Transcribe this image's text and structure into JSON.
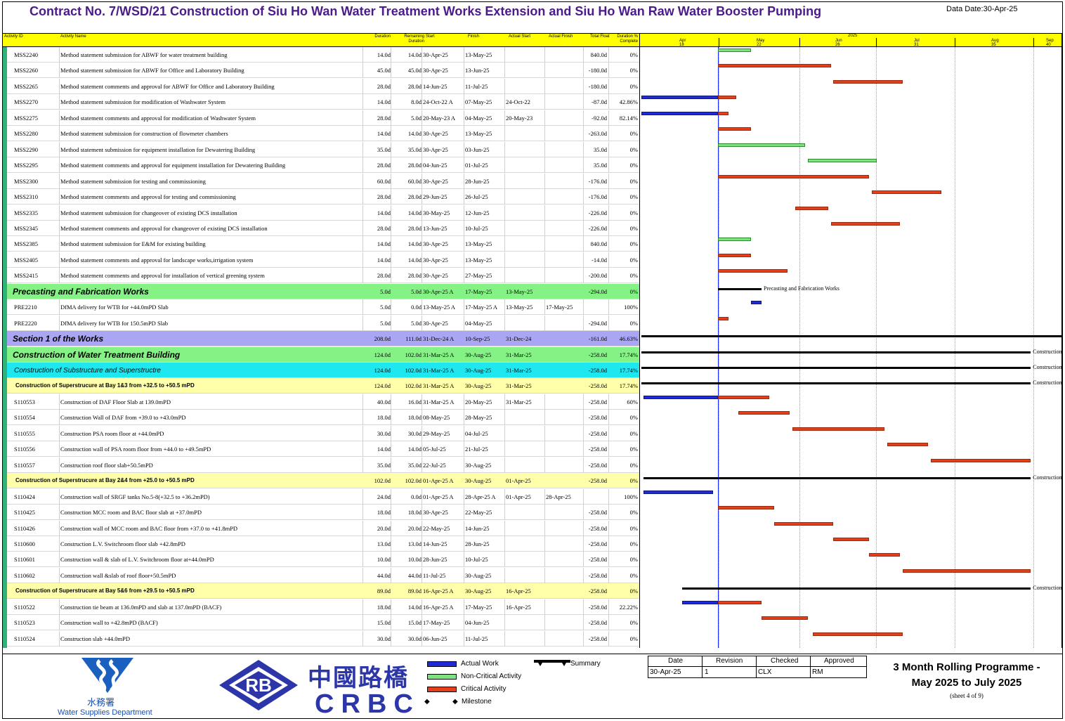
{
  "title": "Contract No. 7/WSD/21 Construction of Siu Ho Wan Water Treatment Works Extension and Siu Ho Wan Raw Water Booster Pumping",
  "data_date": "Data Date:30-Apr-25",
  "columns": {
    "id": "Activity ID",
    "name": "Activity Name",
    "od": "Duration",
    "rd": "Remaining Duration",
    "start": "Start",
    "finish": "Finish",
    "as": "Actual Start",
    "af": "Actual Finish",
    "tf": "Total Float",
    "pc": "Duration % Complete"
  },
  "timeline": {
    "year": "2025",
    "months": [
      "Apr",
      "May",
      "Jun",
      "Jul",
      "Aug",
      "Sep"
    ],
    "weeks": [
      "18",
      "22",
      "26",
      "31",
      "35",
      "40"
    ]
  },
  "colors": {
    "critical": "#e23f1d",
    "non_critical": "#7fe07f",
    "actual": "#1f2bd6",
    "summary": "#000000",
    "group_green": "#85f285",
    "group_purple": "#aaa6f4",
    "group_cyan": "#1fe7ef",
    "group_yellow": "#ffffaa"
  },
  "rows": [
    {
      "type": "act",
      "id": "MSS2240",
      "name": "Method statement submission for ABWF for water treatment building",
      "od": "14.0d",
      "rd": "14.0d",
      "start": "30-Apr-25",
      "finish": "13-May-25",
      "as": "",
      "af": "",
      "tf": "840.0d",
      "pc": "0%",
      "bars": [
        {
          "kind": "nonc",
          "s": 0,
          "e": 13
        }
      ]
    },
    {
      "type": "act",
      "id": "MSS2260",
      "name": "Method statement submission for ABWF for Office and Laboratory Building",
      "od": "45.0d",
      "rd": "45.0d",
      "start": "30-Apr-25",
      "finish": "13-Jun-25",
      "as": "",
      "af": "",
      "tf": "-180.0d",
      "pc": "0%",
      "bars": [
        {
          "kind": "crit",
          "s": 0,
          "e": 44
        }
      ]
    },
    {
      "type": "act",
      "id": "MSS2265",
      "name": "Method statement comments and approval for ABWF for Office and Laboratory Building",
      "od": "28.0d",
      "rd": "28.0d",
      "start": "14-Jun-25",
      "finish": "11-Jul-25",
      "as": "",
      "af": "",
      "tf": "-180.0d",
      "pc": "0%",
      "bars": [
        {
          "kind": "crit",
          "s": 45,
          "e": 72
        }
      ]
    },
    {
      "type": "act",
      "id": "MSS2270",
      "name": "Method statement submission for modification of Washwater System",
      "od": "14.0d",
      "rd": "8.0d",
      "start": "24-Oct-22 A",
      "finish": "07-May-25",
      "as": "24-Oct-22",
      "af": "",
      "tf": "-87.0d",
      "pc": "42.86%",
      "bars": [
        {
          "kind": "act",
          "s": -30,
          "e": 0
        },
        {
          "kind": "crit",
          "s": 0,
          "e": 7
        }
      ]
    },
    {
      "type": "act",
      "id": "MSS2275",
      "name": "Method statement comments and approval for modification of Washwater System",
      "od": "28.0d",
      "rd": "5.0d",
      "start": "20-May-23 A",
      "finish": "04-May-25",
      "as": "20-May-23",
      "af": "",
      "tf": "-92.0d",
      "pc": "82.14%",
      "bars": [
        {
          "kind": "act",
          "s": -30,
          "e": 0
        },
        {
          "kind": "crit",
          "s": 0,
          "e": 4
        }
      ]
    },
    {
      "type": "act",
      "id": "MSS2280",
      "name": "Method statement submission for construction of flowmeter chambers",
      "od": "14.0d",
      "rd": "14.0d",
      "start": "30-Apr-25",
      "finish": "13-May-25",
      "as": "",
      "af": "",
      "tf": "-263.0d",
      "pc": "0%",
      "bars": [
        {
          "kind": "crit",
          "s": 0,
          "e": 13
        }
      ]
    },
    {
      "type": "act",
      "id": "MSS2290",
      "name": "Method statement submission for equipment installation for Dewatering Building",
      "od": "35.0d",
      "rd": "35.0d",
      "start": "30-Apr-25",
      "finish": "03-Jun-25",
      "as": "",
      "af": "",
      "tf": "35.0d",
      "pc": "0%",
      "bars": [
        {
          "kind": "nonc",
          "s": 0,
          "e": 34
        }
      ]
    },
    {
      "type": "act",
      "id": "MSS2295",
      "name": "Method statement comments and approval for equipment installation for Dewatering Building",
      "od": "28.0d",
      "rd": "28.0d",
      "start": "04-Jun-25",
      "finish": "01-Jul-25",
      "as": "",
      "af": "",
      "tf": "35.0d",
      "pc": "0%",
      "bars": [
        {
          "kind": "nonc",
          "s": 35,
          "e": 62
        }
      ]
    },
    {
      "type": "act",
      "id": "MSS2300",
      "name": "Method statement submission for testing and commissioning",
      "od": "60.0d",
      "rd": "60.0d",
      "start": "30-Apr-25",
      "finish": "28-Jun-25",
      "as": "",
      "af": "",
      "tf": "-176.0d",
      "pc": "0%",
      "bars": [
        {
          "kind": "crit",
          "s": 0,
          "e": 59
        }
      ]
    },
    {
      "type": "act",
      "id": "MSS2310",
      "name": "Method statement comments and approval for testing and commissioning",
      "od": "28.0d",
      "rd": "28.0d",
      "start": "29-Jun-25",
      "finish": "26-Jul-25",
      "as": "",
      "af": "",
      "tf": "-176.0d",
      "pc": "0%",
      "bars": [
        {
          "kind": "crit",
          "s": 60,
          "e": 87
        }
      ]
    },
    {
      "type": "act",
      "id": "MSS2335",
      "name": "Method statement submission for changeover of existing DCS installation",
      "od": "14.0d",
      "rd": "14.0d",
      "start": "30-May-25",
      "finish": "12-Jun-25",
      "as": "",
      "af": "",
      "tf": "-226.0d",
      "pc": "0%",
      "bars": [
        {
          "kind": "crit",
          "s": 30,
          "e": 43
        }
      ]
    },
    {
      "type": "act",
      "id": "MSS2345",
      "name": "Method statement comments and approval for changeover of existing DCS installation",
      "od": "28.0d",
      "rd": "28.0d",
      "start": "13-Jun-25",
      "finish": "10-Jul-25",
      "as": "",
      "af": "",
      "tf": "-226.0d",
      "pc": "0%",
      "bars": [
        {
          "kind": "crit",
          "s": 44,
          "e": 71
        }
      ]
    },
    {
      "type": "act",
      "id": "MSS2385",
      "name": "Method statement submission for E&M for existing building",
      "od": "14.0d",
      "rd": "14.0d",
      "start": "30-Apr-25",
      "finish": "13-May-25",
      "as": "",
      "af": "",
      "tf": "840.0d",
      "pc": "0%",
      "bars": [
        {
          "kind": "nonc",
          "s": 0,
          "e": 13
        }
      ]
    },
    {
      "type": "act",
      "id": "MSS2405",
      "name": "Method statement comments and approval for landscape works,irrigation system",
      "od": "14.0d",
      "rd": "14.0d",
      "start": "30-Apr-25",
      "finish": "13-May-25",
      "as": "",
      "af": "",
      "tf": "-14.0d",
      "pc": "0%",
      "bars": [
        {
          "kind": "crit",
          "s": 0,
          "e": 13
        }
      ]
    },
    {
      "type": "act",
      "id": "MSS2415",
      "name": "Method statement comments and approval for  installation of vertical greening system",
      "od": "28.0d",
      "rd": "28.0d",
      "start": "30-Apr-25",
      "finish": "27-May-25",
      "as": "",
      "af": "",
      "tf": "-200.0d",
      "pc": "0%",
      "bars": [
        {
          "kind": "crit",
          "s": 0,
          "e": 27
        }
      ]
    },
    {
      "type": "grp",
      "bg": "#85f285",
      "id": "Precasting and Fabrication Works",
      "name": "",
      "od": "5.0d",
      "rd": "5.0d",
      "start": "30-Apr-25 A",
      "finish": "17-May-25",
      "as": "13-May-25",
      "af": "",
      "tf": "-294.0d",
      "pc": "0%",
      "sum": {
        "s": 0,
        "e": 17
      },
      "label": "Precasting and Fabrication Works"
    },
    {
      "type": "act",
      "id": "PRE2210",
      "name": "DfMA delivery for WTB for +44.0mPD Slab",
      "od": "5.0d",
      "rd": "0.0d",
      "start": "13-May-25 A",
      "finish": "17-May-25 A",
      "as": "13-May-25",
      "af": "17-May-25",
      "tf": "",
      "pc": "100%",
      "bars": [
        {
          "kind": "act",
          "s": 13,
          "e": 17
        }
      ]
    },
    {
      "type": "act",
      "id": "PRE2220",
      "name": "DfMA delivery for WTB for 150.5mPD Slab",
      "od": "5.0d",
      "rd": "5.0d",
      "start": "30-Apr-25",
      "finish": "04-May-25",
      "as": "",
      "af": "",
      "tf": "-294.0d",
      "pc": "0%",
      "bars": [
        {
          "kind": "crit",
          "s": 0,
          "e": 4
        }
      ]
    },
    {
      "type": "grp",
      "bg": "#aaa6f4",
      "id": "Section 1 of the Works",
      "name": "",
      "od": "208.0d",
      "rd": "111.0d",
      "start": "31-Dec-24 A",
      "finish": "10-Sep-25",
      "as": "31-Dec-24",
      "af": "",
      "tf": "-161.0d",
      "pc": "46.63%",
      "sum": {
        "s": -30,
        "e": 135
      },
      "label": ""
    },
    {
      "type": "grp",
      "bg": "#85f285",
      "id": "Construction of Water Treatment Building",
      "name": "",
      "od": "124.0d",
      "rd": "102.0d",
      "start": "31-Mar-25 A",
      "finish": "30-Aug-25",
      "as": "31-Mar-25",
      "af": "",
      "tf": "-258.0d",
      "pc": "17.74%",
      "sum": {
        "s": -30,
        "e": 122
      },
      "label": "Construction"
    },
    {
      "type": "grp3",
      "bg": "#1fe7ef",
      "id": "Construction of Substructure and Superstructre",
      "name": "",
      "od": "124.0d",
      "rd": "102.0d",
      "start": "31-Mar-25 A",
      "finish": "30-Aug-25",
      "as": "31-Mar-25",
      "af": "",
      "tf": "-258.0d",
      "pc": "17.74%",
      "sum": {
        "s": -30,
        "e": 122
      },
      "label": "Construction"
    },
    {
      "type": "grp4",
      "bg": "#ffffaa",
      "id": "Construction of Superstrucure at Bay 1&3 from +32.5 to +50.5 mPD",
      "name": "",
      "od": "124.0d",
      "rd": "102.0d",
      "start": "31-Mar-25 A",
      "finish": "30-Aug-25",
      "as": "31-Mar-25",
      "af": "",
      "tf": "-258.0d",
      "pc": "17.74%",
      "sum": {
        "s": -30,
        "e": 122
      },
      "label": "Construction"
    },
    {
      "type": "act",
      "id": "S110553",
      "name": "Construction of DAF Floor Slab at 139.0mPD",
      "od": "40.0d",
      "rd": "16.0d",
      "start": "31-Mar-25 A",
      "finish": "20-May-25",
      "as": "31-Mar-25",
      "af": "",
      "tf": "-258.0d",
      "pc": "60%",
      "bars": [
        {
          "kind": "act",
          "s": -29,
          "e": 0
        },
        {
          "kind": "crit",
          "s": 0,
          "e": 20
        }
      ]
    },
    {
      "type": "act",
      "id": "S110554",
      "name": "Construction Wall of DAF from +39.0 to +43.0mPD",
      "od": "18.0d",
      "rd": "18.0d",
      "start": "08-May-25",
      "finish": "28-May-25",
      "as": "",
      "af": "",
      "tf": "-258.0d",
      "pc": "0%",
      "bars": [
        {
          "kind": "crit",
          "s": 8,
          "e": 28
        }
      ]
    },
    {
      "type": "act",
      "id": "S110555",
      "name": "Construction PSA room floor at +44.0mPD",
      "od": "30.0d",
      "rd": "30.0d",
      "start": "29-May-25",
      "finish": "04-Jul-25",
      "as": "",
      "af": "",
      "tf": "-258.0d",
      "pc": "0%",
      "bars": [
        {
          "kind": "crit",
          "s": 29,
          "e": 65
        }
      ]
    },
    {
      "type": "act",
      "id": "S110556",
      "name": "Construction wall of PSA room floor from +44.0 to +49.5mPD",
      "od": "14.0d",
      "rd": "14.0d",
      "start": "05-Jul-25",
      "finish": "21-Jul-25",
      "as": "",
      "af": "",
      "tf": "-258.0d",
      "pc": "0%",
      "bars": [
        {
          "kind": "crit",
          "s": 66,
          "e": 82
        }
      ]
    },
    {
      "type": "act",
      "id": "S110557",
      "name": "Construction roof floor slab+50.5mPD",
      "od": "35.0d",
      "rd": "35.0d",
      "start": "22-Jul-25",
      "finish": "30-Aug-25",
      "as": "",
      "af": "",
      "tf": "-258.0d",
      "pc": "0%",
      "bars": [
        {
          "kind": "crit",
          "s": 83,
          "e": 122
        }
      ]
    },
    {
      "type": "grp4",
      "bg": "#ffffaa",
      "id": "Construction of Superstrucure at Bay 2&4 from +25.0 to +50.5 mPD",
      "name": "",
      "od": "102.0d",
      "rd": "102.0d",
      "start": "01-Apr-25 A",
      "finish": "30-Aug-25",
      "as": "01-Apr-25",
      "af": "",
      "tf": "-258.0d",
      "pc": "0%",
      "sum": {
        "s": -29,
        "e": 122
      },
      "label": "Construction"
    },
    {
      "type": "act",
      "id": "S110424",
      "name": "Construction wall of SRGF tanks No.5-8(+32.5 to +36.2mPD)",
      "od": "24.0d",
      "rd": "0.0d",
      "start": "01-Apr-25 A",
      "finish": "28-Apr-25 A",
      "as": "01-Apr-25",
      "af": "28-Apr-25",
      "tf": "",
      "pc": "100%",
      "bars": [
        {
          "kind": "act",
          "s": -29,
          "e": -2
        }
      ]
    },
    {
      "type": "act",
      "id": "S110425",
      "name": "Construction MCC room and BAC floor slab at +37.0mPD",
      "od": "18.0d",
      "rd": "18.0d",
      "start": "30-Apr-25",
      "finish": "22-May-25",
      "as": "",
      "af": "",
      "tf": "-258.0d",
      "pc": "0%",
      "bars": [
        {
          "kind": "crit",
          "s": 0,
          "e": 22
        }
      ]
    },
    {
      "type": "act",
      "id": "S110426",
      "name": "Construction wall of MCC room and BAC floor from +37.0 to +41.8mPD",
      "od": "20.0d",
      "rd": "20.0d",
      "start": "22-May-25",
      "finish": "14-Jun-25",
      "as": "",
      "af": "",
      "tf": "-258.0d",
      "pc": "0%",
      "bars": [
        {
          "kind": "crit",
          "s": 22,
          "e": 45
        }
      ]
    },
    {
      "type": "act",
      "id": "S110600",
      "name": "Construction L.V. Switchroom floor slab +42.8mPD",
      "od": "13.0d",
      "rd": "13.0d",
      "start": "14-Jun-25",
      "finish": "28-Jun-25",
      "as": "",
      "af": "",
      "tf": "-258.0d",
      "pc": "0%",
      "bars": [
        {
          "kind": "crit",
          "s": 45,
          "e": 59
        }
      ]
    },
    {
      "type": "act",
      "id": "S110601",
      "name": "Construction wall & slab of L.V. Switchroom floor at+44.0mPD",
      "od": "10.0d",
      "rd": "10.0d",
      "start": "28-Jun-25",
      "finish": "10-Jul-25",
      "as": "",
      "af": "",
      "tf": "-258.0d",
      "pc": "0%",
      "bars": [
        {
          "kind": "crit",
          "s": 59,
          "e": 71
        }
      ]
    },
    {
      "type": "act",
      "id": "S110602",
      "name": "Construction wall &slab of roof floor+50.5mPD",
      "od": "44.0d",
      "rd": "44.0d",
      "start": "11-Jul-25",
      "finish": "30-Aug-25",
      "as": "",
      "af": "",
      "tf": "-258.0d",
      "pc": "0%",
      "bars": [
        {
          "kind": "crit",
          "s": 72,
          "e": 122
        }
      ]
    },
    {
      "type": "grp4",
      "bg": "#ffffaa",
      "id": "Construction of Superstrucure at Bay 5&6  from +29.5 to +50.5 mPD",
      "name": "",
      "od": "89.0d",
      "rd": "89.0d",
      "start": "16-Apr-25 A",
      "finish": "30-Aug-25",
      "as": "16-Apr-25",
      "af": "",
      "tf": "-258.0d",
      "pc": "0%",
      "sum": {
        "s": -14,
        "e": 122
      },
      "label": "Construction"
    },
    {
      "type": "act",
      "id": "S110522",
      "name": "Construction tie beam at 136.0mPD and slab at 137.0mPD (BACF)",
      "od": "18.0d",
      "rd": "14.0d",
      "start": "16-Apr-25 A",
      "finish": "17-May-25",
      "as": "16-Apr-25",
      "af": "",
      "tf": "-258.0d",
      "pc": "22.22%",
      "bars": [
        {
          "kind": "act",
          "s": -14,
          "e": 0
        },
        {
          "kind": "crit",
          "s": 0,
          "e": 17
        }
      ]
    },
    {
      "type": "act",
      "id": "S110523",
      "name": "Construction wall to +42.8mPD (BACF)",
      "od": "15.0d",
      "rd": "15.0d",
      "start": "17-May-25",
      "finish": "04-Jun-25",
      "as": "",
      "af": "",
      "tf": "-258.0d",
      "pc": "0%",
      "bars": [
        {
          "kind": "crit",
          "s": 17,
          "e": 35
        }
      ]
    },
    {
      "type": "act",
      "id": "S110524",
      "name": "Construction slab +44.0mPD",
      "od": "30.0d",
      "rd": "30.0d",
      "start": "06-Jun-25",
      "finish": "11-Jul-25",
      "as": "",
      "af": "",
      "tf": "-258.0d",
      "pc": "0%",
      "bars": [
        {
          "kind": "crit",
          "s": 37,
          "e": 72
        }
      ]
    }
  ],
  "legend": {
    "actual": "Actual Work",
    "noncrit": "Non-Critical Activity",
    "crit": "Critical Activity",
    "milestone": "Milestone",
    "summary": "Summary"
  },
  "revision": {
    "headers": [
      "Date",
      "Revision",
      "Checked",
      "Approved"
    ],
    "values": [
      "30-Apr-25",
      "1",
      "CLX",
      "RM"
    ]
  },
  "programme": {
    "line1": "3 Month Rolling Programme -",
    "line2": "May 2025 to July 2025",
    "sheet": "(sheet 4 of 9)"
  },
  "logos": {
    "wsd_chinese": "水務署",
    "wsd_english": "Water Supplies Department",
    "rb": "RB",
    "crbc_chinese": "中國路橋",
    "crbc_english": "CRBC"
  }
}
